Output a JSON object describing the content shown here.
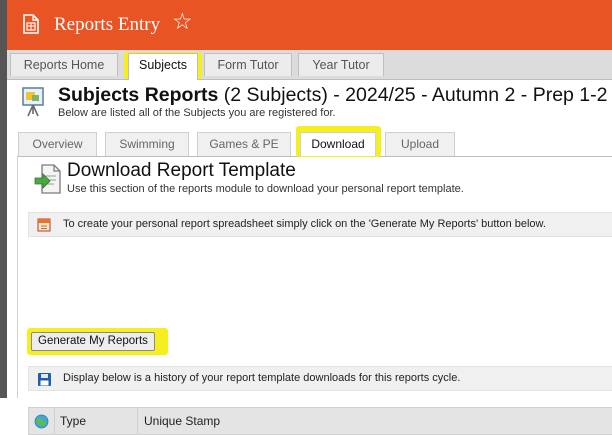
{
  "header": {
    "title": "Reports Entry",
    "star_icon": "star-outline-icon",
    "doc_icon": "document-icon",
    "bg_color": "#e85423"
  },
  "top_tabs": [
    {
      "label": "Reports Home",
      "active": false
    },
    {
      "label": "Subjects",
      "active": true
    },
    {
      "label": "Form Tutor",
      "active": false
    },
    {
      "label": "Year Tutor",
      "active": false
    }
  ],
  "page": {
    "title_bold": "Subjects Reports",
    "title_rest": " (2 Subjects) - 2024/25 - Autumn 2 - Prep 1-2",
    "subtitle": "Below are listed all of the Subjects you are registered for.",
    "icon": "presentation-board-icon"
  },
  "sub_tabs": [
    {
      "label": "Overview",
      "active": false
    },
    {
      "label": "Swimming",
      "active": false
    },
    {
      "label": "Games & PE",
      "active": false
    },
    {
      "label": "Download",
      "active": true
    },
    {
      "label": "Upload",
      "active": false
    }
  ],
  "section": {
    "title": "Download Report Template",
    "subtitle": "Use this section of the reports module to download your personal report template.",
    "icon": "download-document-icon"
  },
  "info1": {
    "text": "To create your personal report spreadsheet simply click on the 'Generate My Reports' button below.",
    "icon": "spreadsheet-icon"
  },
  "generate_button": {
    "label": "Generate My Reports"
  },
  "info2": {
    "text": "Display below is a history of your report template downloads for this reports cycle.",
    "icon": "save-disk-icon"
  },
  "table": {
    "icon": "globe-icon",
    "columns": [
      "Type",
      "Unique Stamp"
    ]
  },
  "colors": {
    "accent": "#e85423",
    "highlight": "#f5ef1f"
  }
}
